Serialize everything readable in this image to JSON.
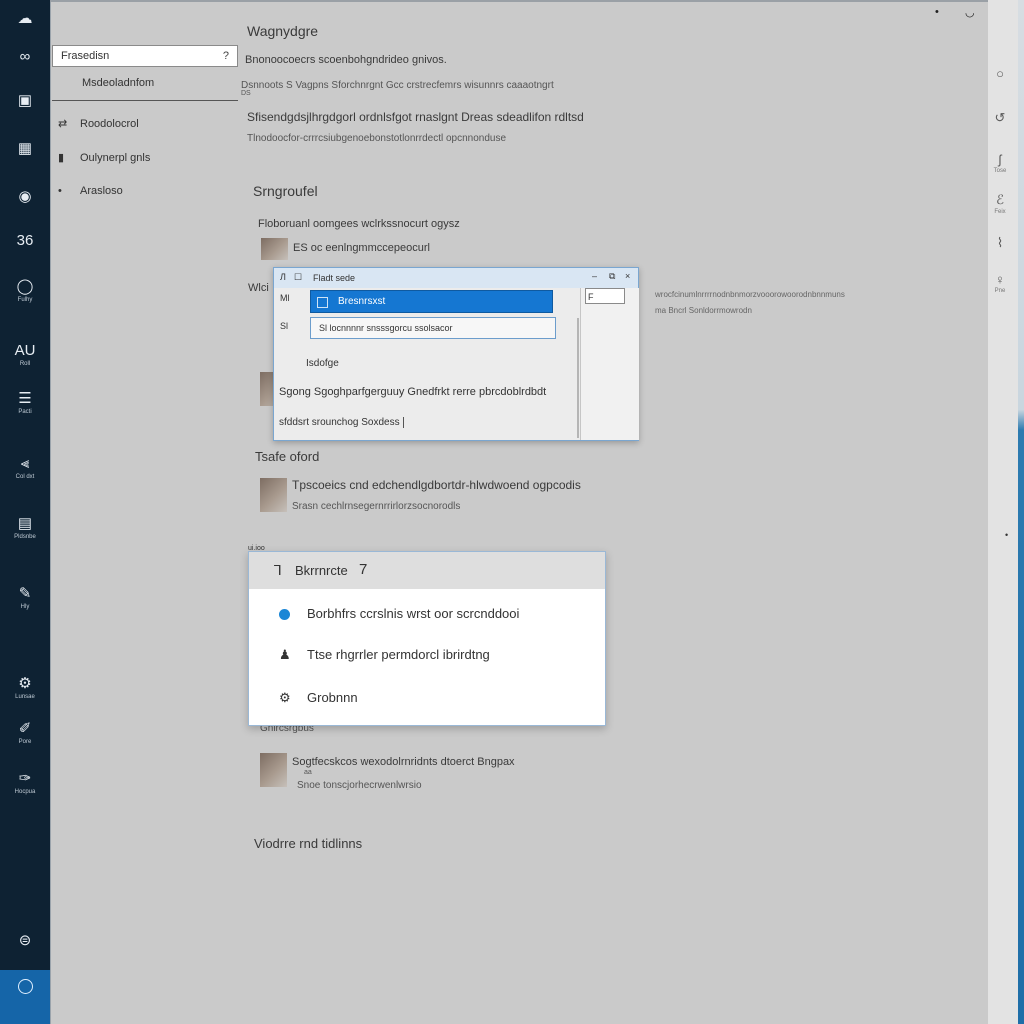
{
  "rail": {
    "items": [
      {
        "icon": "cloud-icon",
        "glyph": "☁",
        "label": ""
      },
      {
        "icon": "link-icon",
        "glyph": "∞",
        "label": ""
      },
      {
        "icon": "photo-icon",
        "glyph": "▣",
        "label": ""
      },
      {
        "icon": "grid-icon",
        "glyph": "▦",
        "label": ""
      },
      {
        "icon": "circle-icon",
        "glyph": "◉",
        "label": ""
      },
      {
        "icon": "numbers-icon",
        "glyph": "36",
        "label": ""
      },
      {
        "icon": "globe-icon",
        "glyph": "◯",
        "label": "Fulhy"
      },
      {
        "icon": "text-icon",
        "glyph": "AU",
        "label": "Roll"
      },
      {
        "icon": "list-icon",
        "glyph": "☰",
        "label": "Pacti"
      },
      {
        "icon": "chart-icon",
        "glyph": "⫷",
        "label": "Col dxt"
      },
      {
        "icon": "book-icon",
        "glyph": "▤",
        "label": "Pldsnbe"
      },
      {
        "icon": "pen-icon",
        "glyph": "✎",
        "label": "Hly"
      },
      {
        "icon": "settings-icon",
        "glyph": "⚙",
        "label": "Lunsae"
      },
      {
        "icon": "edit-icon",
        "glyph": "✐",
        "label": "Pore"
      },
      {
        "icon": "brush-icon",
        "glyph": "✑",
        "label": "Hocpua"
      },
      {
        "icon": "badge-icon",
        "glyph": "⊜",
        "label": ""
      }
    ]
  },
  "window_controls": [
    "•",
    "◡",
    "▲"
  ],
  "sidebar": {
    "search_text": "Frasedisn",
    "search_hint": "?",
    "subhead": "Msdeoladnfom",
    "nav": [
      {
        "icon": "sync-icon",
        "glyph": "⇄",
        "label": "Roodolocrol"
      },
      {
        "icon": "doc-icon",
        "glyph": "▮",
        "label": "Oulynerpl gnls"
      },
      {
        "icon": "dot-icon",
        "glyph": "•",
        "label": "Arasloso"
      }
    ]
  },
  "main": {
    "title": "Wagnydgre",
    "lines": [
      "Bnonoocoecrs scoenbohgndrideo gnivos.",
      "Dsnnoots S Vagpns Sforchnrgnt Gcc crstrecfemrs wisunnrs caaaotngrt",
      "DS",
      "Sfisendgdsjlhrgdgorl ordnlsfgot rnaslgnt Dreas sdeadlifon rdltsd",
      "Tlnodoocfor-crrrcsiubgenoebonstotlonrrdectl opcnnonduse"
    ],
    "section1": "Srngroufel",
    "s1_line": "Floboruanl oomgees wclrkssnocurt ogysz",
    "s1_item": "ES oc eenlngmmccepeocurl",
    "side_label": "Wlci",
    "side_note_1": "wrocfcinumlnrrrrnodnbnmorzvooorowoorodnbnnmuns",
    "side_note_2": "ma Bncrl Sonldorrmowrodn",
    "section2": "Tsafe oford",
    "s2_title": "Tpscoeics cnd edchendlgdbortdr-hlwdwoend ogpcodis",
    "s2_sub": "Srasn cechlrnsegernrrirlorzsocnorodls",
    "s3_label": "Gnlrcsrgbus",
    "s3_title": "Sogtfecskcos wexodolrnridnts dtoerct Bngpax",
    "s3_sub": "Snoe tonscjorhecrwenlwrsio",
    "s3_sub2": "aa",
    "footer_heading": "Viodrre rnd tidlinns"
  },
  "dialog": {
    "title": "Fladt sede",
    "left_icons": [
      "Л",
      "Ml",
      "Sl"
    ],
    "selected": "Bresnrsxst",
    "row2": "Sl locnnnnr snsssgorcu ssolsacor",
    "rp_box": "F",
    "line1": "Isdofge",
    "line2": "Sgong Sgoghparfgerguuy Gnedfrkt rerre pbrcdoblrdbdt",
    "line3": "sfddsrt srounchog Soxdess"
  },
  "flyout": {
    "pre_label": "ui.ioo",
    "header": "Bkrrnrcte",
    "header_num": "7",
    "items": [
      {
        "icon": "bluedot-icon",
        "label": "Borbhfrs ccrslnis wrst oor scrcnddooi"
      },
      {
        "icon": "mic-icon",
        "label": "Ttse rhgrrler permdorcl ibrirdtng"
      },
      {
        "icon": "gear-icon",
        "label": "Grobnnn"
      }
    ]
  },
  "right_rail": [
    {
      "icon": "circle-icon",
      "glyph": "○",
      "label": ""
    },
    {
      "icon": "loop-icon",
      "glyph": "↺",
      "label": ""
    },
    {
      "icon": "hook-icon",
      "glyph": "ʃ",
      "label": "Tose"
    },
    {
      "icon": "swirl-icon",
      "glyph": "ℰ",
      "label": "Feix"
    },
    {
      "icon": "pin-icon",
      "glyph": "⌇",
      "label": ""
    },
    {
      "icon": "bulb-icon",
      "glyph": "♀",
      "label": "Pne"
    }
  ]
}
